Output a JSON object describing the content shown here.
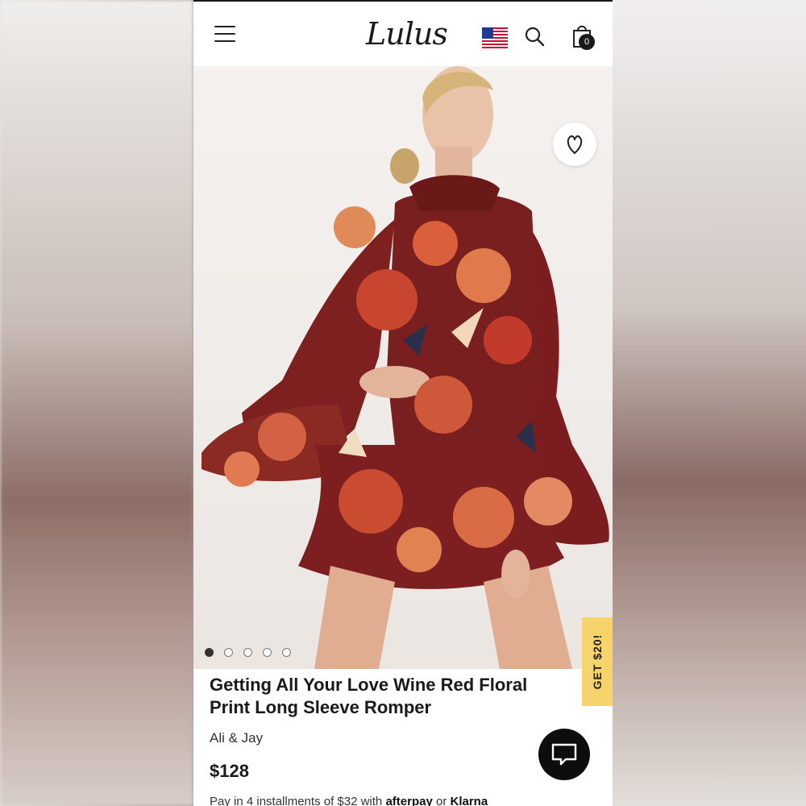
{
  "header": {
    "logo_text": "Lulus",
    "cart_count": "0"
  },
  "gallery": {
    "total_images": 5,
    "active_index": 0
  },
  "promo_tab": {
    "label": "GET $20!"
  },
  "product": {
    "title": "Getting All Your Love Wine Red Floral Print Long Sleeve Romper",
    "brand": "Ali & Jay",
    "price": "$128",
    "installments_prefix": "Pay in 4 installments of $32 with",
    "installments_provider_1": "afterpay",
    "installments_or": "or",
    "installments_provider_2": "Klarna"
  },
  "colors": {
    "promo_yellow": "#f7d46b",
    "text_dark": "#1a1a1a",
    "dress_wine": "#7a1f1f"
  }
}
